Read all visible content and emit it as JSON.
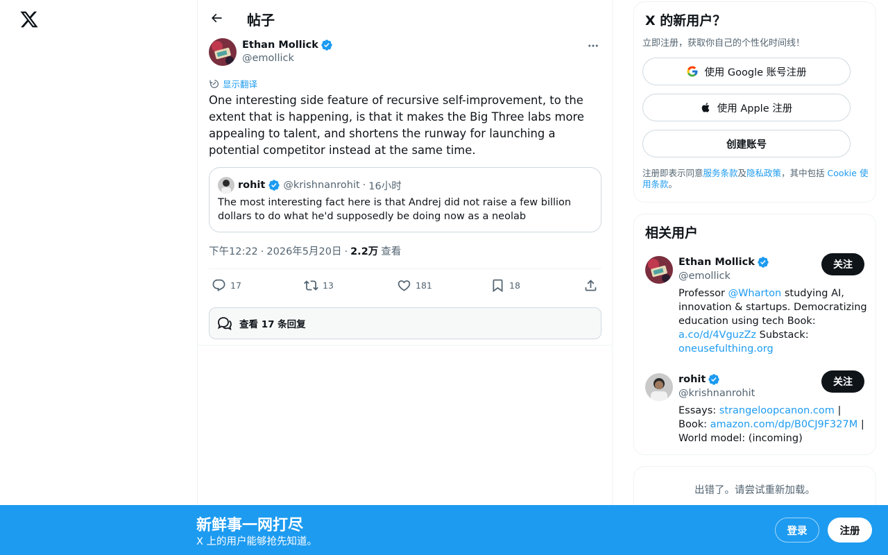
{
  "header": {
    "title": "帖子"
  },
  "post": {
    "author_name": "Ethan Mollick",
    "author_handle": "@emollick",
    "translate_label": "显示翻译",
    "text": "One interesting side feature of recursive self-improvement, to the extent that is happening, is that it makes the Big Three labs more appealing to talent, and shortens the runway for launching a potential competitor instead at the same time.",
    "quote": {
      "name": "rohit",
      "handle": "@krishnanrohit",
      "dot": "·",
      "time": "16小时",
      "text": "The most interesting fact here is that Andrej did not raise a few billion dollars to do what he'd supposedly be doing now as a neolab"
    },
    "meta": {
      "time": "下午12:22",
      "sep1": "·",
      "date": "2026年5月20日",
      "sep2": "·",
      "views": "2.2万",
      "views_label": "查看"
    },
    "actions": {
      "replies": "17",
      "reposts": "13",
      "likes": "181",
      "bookmarks": "18"
    },
    "view_replies_label": "查看 17 条回复"
  },
  "signup_card": {
    "title": "X 的新用户？",
    "subtitle": "立即注册，获取你自己的个性化时间线！",
    "google_label": "使用 Google 账号注册",
    "apple_label": "使用 Apple 注册",
    "create_label": "创建账号",
    "terms_prefix": "注册即表示同意",
    "terms_link": "服务条款",
    "terms_and": "及",
    "privacy_link": "隐私政策",
    "terms_mid": "，其中包括 ",
    "cookie_link": "Cookie 使用条款",
    "terms_suffix": "。"
  },
  "related": {
    "title": "相关用户",
    "users": [
      {
        "name": "Ethan Mollick",
        "handle": "@emollick",
        "follow": "关注",
        "bio_1": "Professor ",
        "bio_link_1": "@Wharton",
        "bio_2": " studying AI, innovation & startups. Democratizing education using tech Book: ",
        "bio_link_2": "a.co/d/4VguzZz",
        "bio_3": " Substack: ",
        "bio_link_3": "oneusefulthing.org"
      },
      {
        "name": "rohit",
        "handle": "@krishnanrohit",
        "follow": "关注",
        "bio_1": "Essays: ",
        "bio_link_1": "strangeloopcanon.com",
        "bio_2": " | Book: ",
        "bio_link_2": "amazon.com/dp/B0CJ9F327M",
        "bio_3": " | World model: (incoming)"
      }
    ]
  },
  "error": {
    "text": "出错了。请尝试重新加载。"
  },
  "bottom_bar": {
    "title": "新鲜事一网打尽",
    "subtitle": "X 上的用户能够抢先知道。",
    "login": "登录",
    "signup": "注册"
  },
  "colors": {
    "accent": "#1d9bf0",
    "text": "#0f1419",
    "secondary": "#536471",
    "border": "#eff3f4"
  }
}
